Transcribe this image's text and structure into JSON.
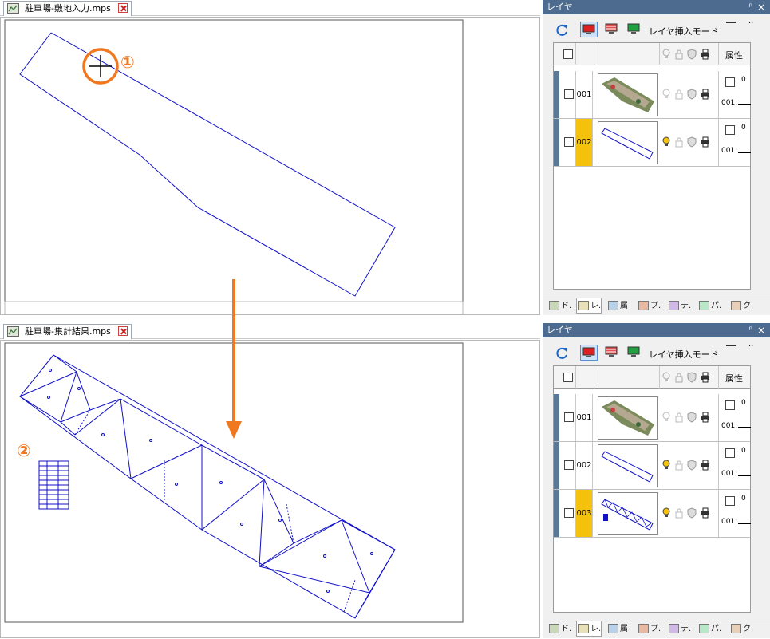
{
  "top_window": {
    "tab_label": "駐車場-敷地入力.mps"
  },
  "bottom_window": {
    "tab_label": "駐車場-集計結果.mps"
  },
  "annotations": {
    "step1": "①",
    "step2": "②",
    "accent_color": "#f07820"
  },
  "layer_panel": {
    "title": "レイヤ",
    "pin_glyph": "ᵖ",
    "close_glyph": "×",
    "mode_label": "レイヤ挿入モード",
    "attr_header": "属性",
    "attr_value": "0",
    "attr_prefix": "001:",
    "colors": {
      "title_bar": "#4d6b8e",
      "selected_layer": "#f4c20d",
      "row_bar": "#5a7897"
    }
  },
  "top_layers": [
    {
      "number": "001",
      "selected": false,
      "thumb": "photo"
    },
    {
      "number": "002",
      "selected": true,
      "thumb": "outline"
    }
  ],
  "bottom_layers": [
    {
      "number": "001",
      "selected": false,
      "thumb": "photo"
    },
    {
      "number": "002",
      "selected": false,
      "thumb": "outline"
    },
    {
      "number": "003",
      "selected": true,
      "thumb": "triangles"
    }
  ],
  "bottom_tabs": [
    "ド.",
    "レ.",
    "属",
    "プ.",
    "テ.",
    "パ.",
    "ク."
  ]
}
